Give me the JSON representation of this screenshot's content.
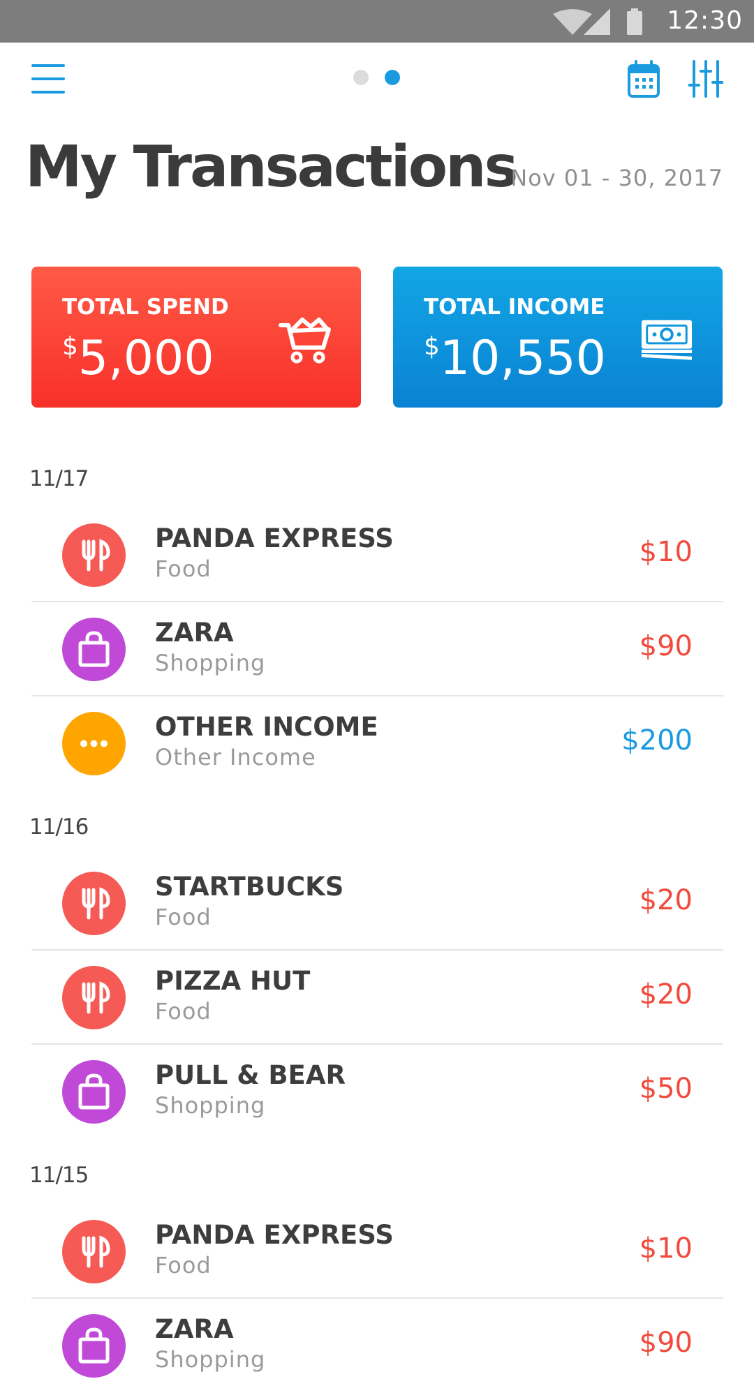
{
  "status_bar": {
    "time": "12:30"
  },
  "header": {
    "title": "My Transactions",
    "date_range": "Nov 01 - 30, 2017"
  },
  "summary": {
    "spend": {
      "label": "TOTAL SPEND",
      "currency": "$",
      "amount": "5,000",
      "color": "#f8302a",
      "icon": "shopping-cart-icon"
    },
    "income": {
      "label": "TOTAL INCOME",
      "currency": "$",
      "amount": "10,550",
      "color": "#0a82d3",
      "icon": "cash-icon"
    }
  },
  "colors": {
    "accent": "#1a9be0",
    "expense_amount": "#f04b3c",
    "income_amount": "#1a9be0",
    "food": "#f55a55",
    "shopping": "#c049d8",
    "other": "#ffa500"
  },
  "groups": [
    {
      "date": "11/17",
      "items": [
        {
          "name": "PANDA EXPRESS",
          "category": "Food",
          "amount": "$10",
          "type": "food",
          "icon": "fork-knife-icon",
          "kind": "expense"
        },
        {
          "name": "ZARA",
          "category": "Shopping",
          "amount": "$90",
          "type": "shopping",
          "icon": "shopping-bag-icon",
          "kind": "expense"
        },
        {
          "name": "OTHER INCOME",
          "category": "Other Income",
          "amount": "$200",
          "type": "other",
          "icon": "more-dots-icon",
          "kind": "income"
        }
      ]
    },
    {
      "date": "11/16",
      "items": [
        {
          "name": "STARTBUCKS",
          "category": "Food",
          "amount": "$20",
          "type": "food",
          "icon": "fork-knife-icon",
          "kind": "expense"
        },
        {
          "name": "PIZZA HUT",
          "category": "Food",
          "amount": "$20",
          "type": "food",
          "icon": "fork-knife-icon",
          "kind": "expense"
        },
        {
          "name": "PULL & BEAR",
          "category": "Shopping",
          "amount": "$50",
          "type": "shopping",
          "icon": "shopping-bag-icon",
          "kind": "expense"
        }
      ]
    },
    {
      "date": "11/15",
      "items": [
        {
          "name": "PANDA EXPRESS",
          "category": "Food",
          "amount": "$10",
          "type": "food",
          "icon": "fork-knife-icon",
          "kind": "expense"
        },
        {
          "name": "ZARA",
          "category": "Shopping",
          "amount": "$90",
          "type": "shopping",
          "icon": "shopping-bag-icon",
          "kind": "expense"
        }
      ]
    }
  ]
}
